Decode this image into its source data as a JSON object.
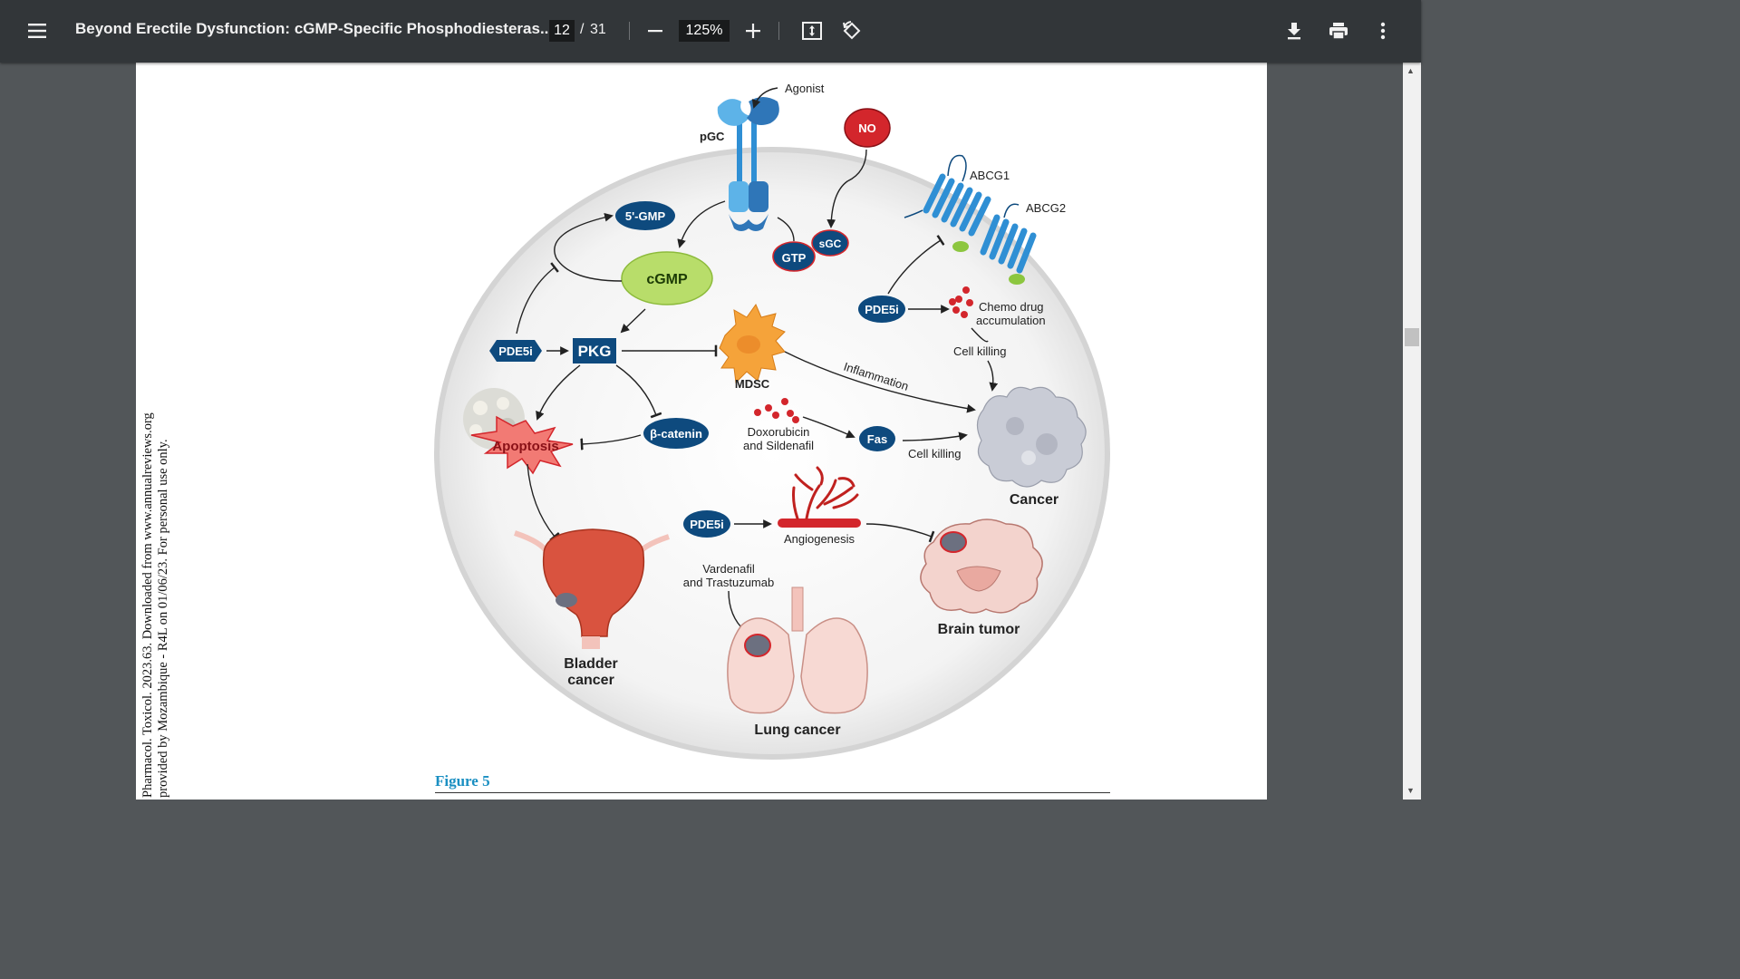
{
  "toolbar": {
    "menu_icon": "hamburger-menu-icon",
    "title": "Beyond Erectile Dysfunction: cGMP-Specific Phosphodiesteras...",
    "page_current": "12",
    "page_separator": "/",
    "page_total": "31",
    "zoom_out_icon": "minus-icon",
    "zoom_value": "125%",
    "zoom_in_icon": "plus-icon",
    "fit_icon": "fit-to-page-icon",
    "rotate_icon": "rotate-icon",
    "download_icon": "download-icon",
    "print_icon": "print-icon",
    "more_icon": "more-vert-icon"
  },
  "document": {
    "side_note_line1": "Pharmacol. Toxicol. 2023.63. Downloaded from www.annualreviews.org",
    "side_note_line2": "provided by Mozambique - R4L on 01/06/23. For personal use only.",
    "figure_caption": "Figure 5"
  },
  "figure": {
    "agonist": "Agonist",
    "pgc": "pGC",
    "no": "NO",
    "abcg1": "ABCG1",
    "abcg2": "ABCG2",
    "gmp5": "5'-GMP",
    "gtp": "GTP",
    "sgc": "sGC",
    "cgmp": "cGMP",
    "pde5i_1": "PDE5i",
    "pde5i_2": "PDE5i",
    "pde5i_3": "PDE5i",
    "pkg": "PKG",
    "mdsc": "MDSC",
    "chemo1": "Chemo drug",
    "chemo2": "accumulation",
    "cell_killing_1": "Cell killing",
    "cell_killing_2": "Cell killing",
    "inflammation": "Inflammation",
    "apoptosis": "Apoptosis",
    "beta_catenin": "β-catenin",
    "doxo1": "Doxorubicin",
    "doxo2": "and Sildenafil",
    "fas": "Fas",
    "cancer": "Cancer",
    "angiogenesis": "Angiogenesis",
    "vard1": "Vardenafil",
    "vard2": "and Trastuzumab",
    "brain_tumor": "Brain tumor",
    "bladder1": "Bladder",
    "bladder2": "cancer",
    "lung_cancer": "Lung cancer"
  },
  "colors": {
    "toolbar_bg": "#323639",
    "viewer_bg": "#525659",
    "navy_node": "#0e4a7e",
    "cgmp_green": "#b8dd6a",
    "no_red": "#d3262c",
    "receptor_blue": "#2f8fd4",
    "caption_blue": "#1a8fc2"
  }
}
